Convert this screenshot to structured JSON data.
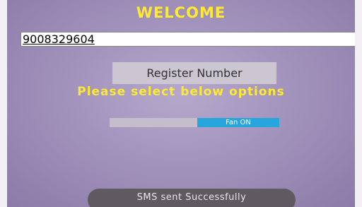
{
  "screen": {
    "welcome_title": "WELCOME",
    "phone_number_value": "9008329604",
    "register_button_label": "Register Number",
    "instruction_text": "Please select below options",
    "fan_toggle_label": "Fan ON",
    "toast_message": "SMS sent Successfully"
  },
  "colors": {
    "accent_yellow": "#ffea2e",
    "toggle_blue": "#26a6dc",
    "background_purple": "#a293bc"
  }
}
